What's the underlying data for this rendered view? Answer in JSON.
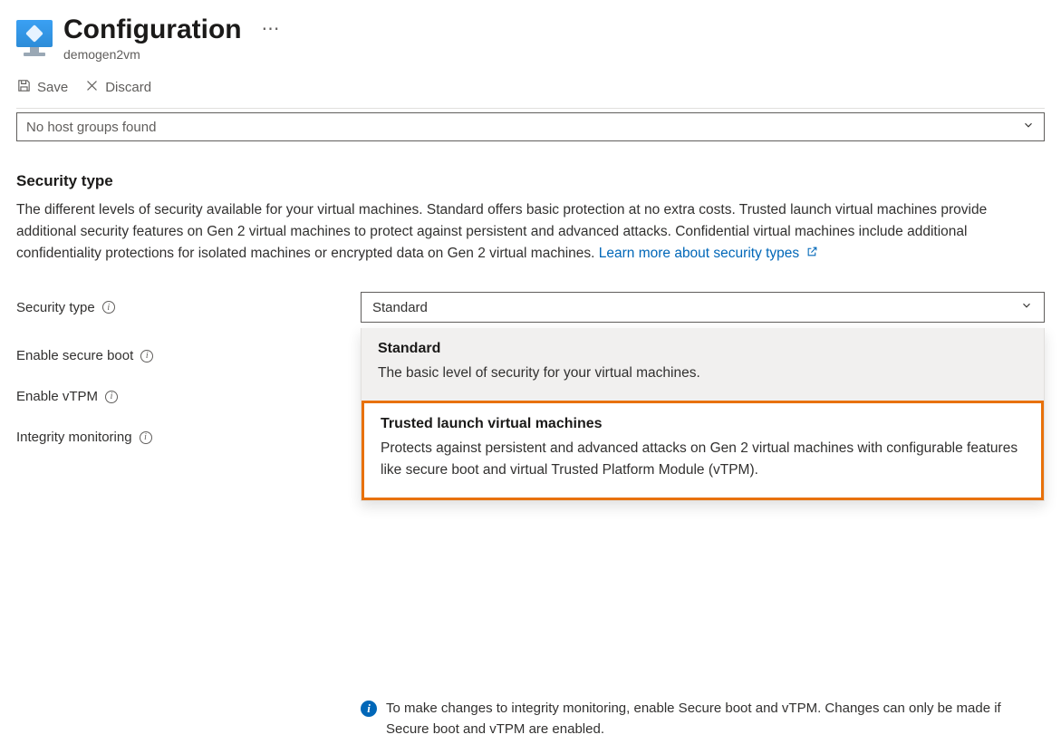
{
  "header": {
    "title": "Configuration",
    "resource_name": "demogen2vm"
  },
  "commands": {
    "save": "Save",
    "discard": "Discard"
  },
  "host_group_dropdown": {
    "value": "No host groups found"
  },
  "security_section": {
    "title": "Security type",
    "description": "The different levels of security available for your virtual machines. Standard offers basic protection at no extra costs. Trusted launch virtual machines provide additional security features on Gen 2 virtual machines to protect against persistent and advanced attacks. Confidential virtual machines include additional confidentiality protections for isolated machines or encrypted data on Gen 2 virtual machines. ",
    "learn_more": "Learn more about security types"
  },
  "form": {
    "security_type_label": "Security type",
    "security_type_value": "Standard",
    "enable_secure_boot_label": "Enable secure boot",
    "enable_vtpm_label": "Enable vTPM",
    "integrity_monitoring_label": "Integrity monitoring"
  },
  "options": {
    "standard": {
      "title": "Standard",
      "desc": "The basic level of security for your virtual machines."
    },
    "trusted": {
      "title": "Trusted launch virtual machines",
      "desc": "Protects against persistent and advanced attacks on Gen 2 virtual machines with configurable features like secure boot and virtual Trusted Platform Module (vTPM)."
    }
  },
  "integrity_info": "To make changes to integrity monitoring, enable Secure boot and vTPM. Changes can only be made if Secure boot and vTPM are enabled."
}
